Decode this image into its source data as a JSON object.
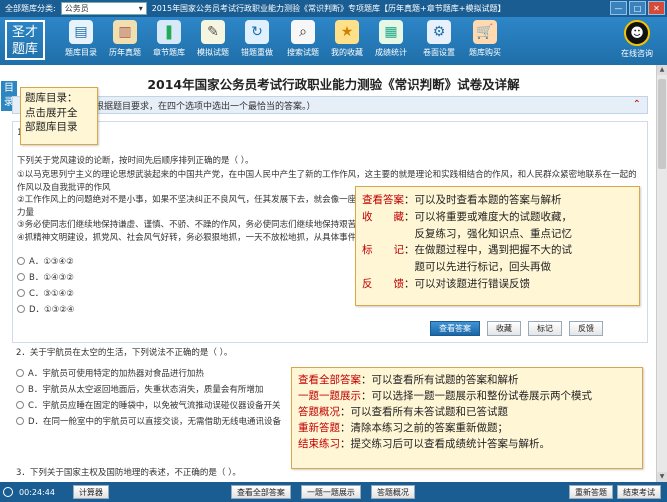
{
  "topbar": {
    "category_label": "全部题库分类:",
    "category_value": "公务员",
    "title": "2015年国家公务员考试行政职业能力测验《常识判断》专项题库【历年真题+章节题库+模拟试题】"
  },
  "logo": {
    "line1": "圣才",
    "line2": "题库"
  },
  "toolbar": {
    "items": [
      {
        "label": "题库目录",
        "icon": "monitor-icon",
        "color": "#e8f2fb"
      },
      {
        "label": "历年真题",
        "icon": "book-icon",
        "color": "#f0e0b0"
      },
      {
        "label": "章节题库",
        "icon": "books-icon",
        "color": "#d7e8f8"
      },
      {
        "label": "模拟试题",
        "icon": "pencil-doc-icon",
        "color": "#f5f5e0"
      },
      {
        "label": "错题重做",
        "icon": "redo-icon",
        "color": "#e0f0ff"
      },
      {
        "label": "搜索试题",
        "icon": "search-icon",
        "color": "#f7f7f7"
      },
      {
        "label": "我的收藏",
        "icon": "star-icon",
        "color": "#ffe08a"
      },
      {
        "label": "成绩统计",
        "icon": "chart-icon",
        "color": "#e6f7e6"
      },
      {
        "label": "卷面设置",
        "icon": "settings-icon",
        "color": "#e7f0fb"
      },
      {
        "label": "题库购买",
        "icon": "cart-icon",
        "color": "#ffd9b0"
      }
    ],
    "qq_label": "在线咨询"
  },
  "sidebar_tab": "目录",
  "paper": {
    "title": "2014年国家公务员考试行政职业能力测验《常识判断》试卷及详解",
    "instruction": "一、单项选择题（根据题目要求，在四个选项中选出一个最恰当的答案。）"
  },
  "q1": {
    "number": "1．",
    "stem": "下列关于党风建设的论断，按时间先后顺序排列正确的是（   ）。",
    "lines": [
      "①以马克思列宁主义的理论思想武装起来的中国共产党，在中国人民中产生了新的工作作风，这主要的就是理论和实践相结合的作风，和人民群众紧密地联系在一起的作风以及自我批评的作风",
      "②工作作风上的问题绝对不是小事，如果不坚决纠正不良风气，任其发展下去，就会像一座无形的墙把我们党和人民群众隔开，我们党就会失去根基、失去血脉、失去力量",
      "③务必使同志们继续地保持谦虚、谨慎、不骄、不躁的作风，务必使同志们继续地保持艰苦奋斗的作风",
      "④抓精神文明建设，抓党风、社会风气好转，务必狠狠地抓，一天不放松地抓，从具体事件抓起"
    ],
    "options": [
      "A．①③④②",
      "B．①④③②",
      "C．③①④②",
      "D．①③②④"
    ],
    "buttons": {
      "answer": "查看答案",
      "favorite": "收藏",
      "mark": "标记",
      "feedback": "反馈"
    }
  },
  "q2": {
    "stem": "2．关于宇航员在太空的生活，下列说法不正确的是（   ）。",
    "options": [
      "A．宇航员可使用特定的加热器对食品进行加热",
      "B．宇航员从太空返回地面后，失重状态消失，质量会有所增加",
      "C．宇航员应睡在固定的睡袋中，以免被气流推动误碰仪器设备开关",
      "D．在同一舱室中的宇航员可以直接交谈，无需借助无线电通讯设备"
    ]
  },
  "q3": {
    "stem": "3．下列关于国家主权及国防地理的表述，不正确的是（   ）。"
  },
  "tips": {
    "catalog": {
      "line1": "题库目录：",
      "line2": "点击展开全",
      "line3": "部题库目录"
    },
    "answer_panel": [
      {
        "key": "查看答案",
        "text": "：可以及时查看本题的答案与解析"
      },
      {
        "key": "收　　藏",
        "text": "：可以将重要或难度大的试题收藏，"
      },
      {
        "key": "",
        "text": "　　　　　反复练习，强化知识点、重点记忆"
      },
      {
        "key": "标　　记",
        "text": "：在做题过程中，遇到把握不大的试"
      },
      {
        "key": "",
        "text": "　　　　　题可以先进行标记，回头再做"
      },
      {
        "key": "反　　馈",
        "text": "：可以对该题进行错误反馈"
      }
    ],
    "bottom_panel": [
      {
        "key": "查看全部答案",
        "text": "：可以查看所有试题的答案和解析"
      },
      {
        "key": "一题一题展示",
        "text": "：可以选择一题一题展示和整份试卷展示两个模式"
      },
      {
        "key": "答题概况",
        "text": "：可以查看所有未答试题和已答试题"
      },
      {
        "key": "重新答题",
        "text": "：清除本练习之前的答案重新做题；"
      },
      {
        "key": "结束练习",
        "text": "：提交练习后可以查看成绩统计答案与解析。"
      }
    ]
  },
  "bottombar": {
    "timer": "00:24:44",
    "calculator": "计算器",
    "view_all": "查看全部答案",
    "one_by_one": "一题一题展示",
    "overview": "答题概况",
    "restart": "重新答题",
    "finish": "结束考试"
  },
  "window": {
    "min": "—",
    "max": "□",
    "close": "✕"
  }
}
